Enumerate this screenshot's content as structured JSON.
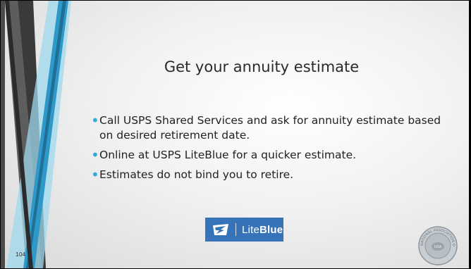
{
  "slide": {
    "title": "Get your annuity estimate",
    "bullets": [
      "Call USPS Shared Services and ask for annuity estimate based on desired retirement date.",
      "Online at USPS LiteBlue for a quicker estimate.",
      "Estimates do not bind you to retire."
    ],
    "bullet_color": "#35a8d6",
    "logo": {
      "prefix": "Lite",
      "bold": "Blue",
      "background": "#3673b8",
      "icon": "usps-eagle-icon"
    },
    "seal": {
      "text": "NATIONAL ASSOCIATION OF LETTER CARRIERS",
      "center": "USA",
      "icon": "nalc-seal-icon"
    },
    "page_number": "104"
  }
}
